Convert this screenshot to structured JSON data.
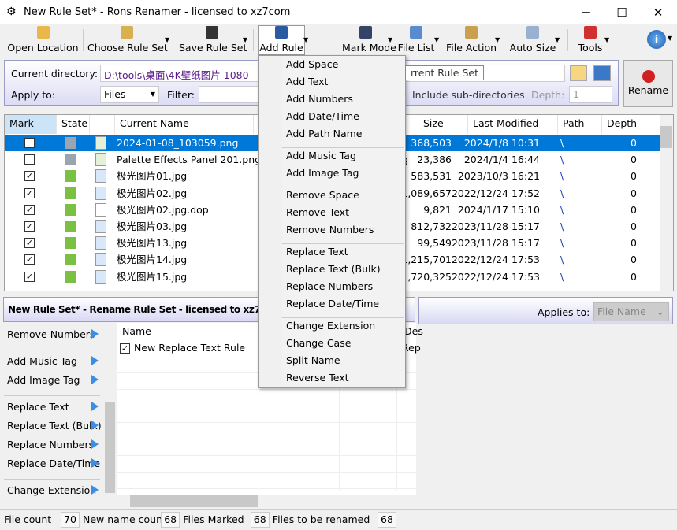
{
  "window": {
    "title": "New Rule Set* - Rons Renamer - licensed to xz7com",
    "minimize": "─",
    "maximize": "☐",
    "close": "✕"
  },
  "toolbar": [
    {
      "label": "Open Location",
      "icon": "folder-open-icon",
      "color": "#e8b84a"
    },
    {
      "label": "Choose Rule Set",
      "icon": "folder-refresh-icon",
      "color": "#d8b050"
    },
    {
      "label": "Save Rule Set",
      "icon": "floppy-disk-icon",
      "color": "#333333"
    },
    {
      "label": "Add Rule",
      "icon": "book-plus-icon",
      "color": "#2a5aa0"
    },
    {
      "label": "Mark Mode",
      "icon": "list-icon",
      "color": "#334466"
    },
    {
      "label": "File List",
      "icon": "grid-edit-icon",
      "color": "#5a8ad0"
    },
    {
      "label": "File Action",
      "icon": "folder-gear-icon",
      "color": "#c8a050"
    },
    {
      "label": "Auto Size",
      "icon": "resize-icon",
      "color": "#9ab0d0"
    },
    {
      "label": "Tools",
      "icon": "tools-icon",
      "color": "#d03030"
    }
  ],
  "directory": {
    "label": "Current directory:",
    "value": "D:\\tools\\桌面\\4K壁纸图片 1080",
    "tooltip": "rrent Rule Set",
    "apply_label": "Apply to:",
    "apply_value": "Files",
    "filter_label": "Filter:",
    "subdirs_label": "Include sub-directories",
    "depth_label": "Depth:",
    "depth_value": "1",
    "rename_label": "Rename"
  },
  "grid": {
    "headers": [
      "Mark",
      "State",
      "",
      "Current Name",
      "Size",
      "Last Modified",
      "Path",
      "Depth"
    ],
    "rows": [
      {
        "checked": false,
        "selected": true,
        "name": "2024-01-08_103059.png",
        "size": "368,503",
        "modified": "2024/1/8 10:31",
        "path": "\\",
        "depth": "0",
        "type": "png"
      },
      {
        "checked": false,
        "name": "Palette Effects Panel 201.png",
        "extra": "g",
        "size": "23,386",
        "modified": "2024/1/4 16:44",
        "path": "\\",
        "depth": "0",
        "type": "png"
      },
      {
        "checked": true,
        "name": "极光图片01.jpg",
        "size": "583,531",
        "modified": "2023/10/3 16:21",
        "path": "\\",
        "depth": "0",
        "type": "jpg"
      },
      {
        "checked": true,
        "name": "极光图片02.jpg",
        "size": "1,089,657",
        "modified": "2022/12/24 17:52",
        "path": "\\",
        "depth": "0",
        "type": "jpg"
      },
      {
        "checked": true,
        "name": "极光图片02.jpg.dop",
        "size": "9,821",
        "modified": "2024/1/17 15:10",
        "path": "\\",
        "depth": "0",
        "type": "file"
      },
      {
        "checked": true,
        "name": "极光图片03.jpg",
        "size": "812,732",
        "modified": "2023/11/28 15:17",
        "path": "\\",
        "depth": "0",
        "type": "jpg"
      },
      {
        "checked": true,
        "name": "极光图片13.jpg",
        "size": "99,549",
        "modified": "2023/11/28 15:17",
        "path": "\\",
        "depth": "0",
        "type": "jpg"
      },
      {
        "checked": true,
        "name": "极光图片14.jpg",
        "size": "1,215,701",
        "modified": "2022/12/24 17:53",
        "path": "\\",
        "depth": "0",
        "type": "jpg"
      },
      {
        "checked": true,
        "name": "极光图片15.jpg",
        "size": "1,720,325",
        "modified": "2022/12/24 17:53",
        "path": "\\",
        "depth": "0",
        "type": "jpg"
      }
    ]
  },
  "menu": {
    "groups": [
      [
        "Add Space",
        "Add Text",
        "Add Numbers",
        "Add Date/Time",
        "Add Path Name"
      ],
      [
        "Add Music Tag",
        "Add Image Tag"
      ],
      [
        "Remove Space",
        "Remove Text",
        "Remove Numbers"
      ],
      [
        "Replace Text",
        "Replace Text (Bulk)",
        "Replace Numbers",
        "Replace Date/Time"
      ],
      [
        "Change Extension",
        "Change Case",
        "Split Name",
        "Reverse Text"
      ]
    ]
  },
  "ruleset": {
    "title": "New Rule Set* - Rename Rule Set - licensed to xz7com",
    "applies_label": "Applies to:",
    "applies_value": "File Name",
    "name_header": "Name",
    "desc_header": "Des",
    "rule": "New Replace Text Rule",
    "rule_desc": "Rep"
  },
  "rule_list": [
    [
      "Remove Numbers"
    ],
    [
      "Add Music Tag",
      "Add Image Tag"
    ],
    [
      "Replace Text",
      "Replace Text (Bulk)",
      "Replace Numbers",
      "Replace Date/Time"
    ],
    [
      "Change Extension"
    ]
  ],
  "status": [
    {
      "label": "File count",
      "value": "70"
    },
    {
      "label": "New name count",
      "value": "68"
    },
    {
      "label": "Files Marked",
      "value": "68"
    },
    {
      "label": "Files to be renamed",
      "value": "68"
    }
  ]
}
